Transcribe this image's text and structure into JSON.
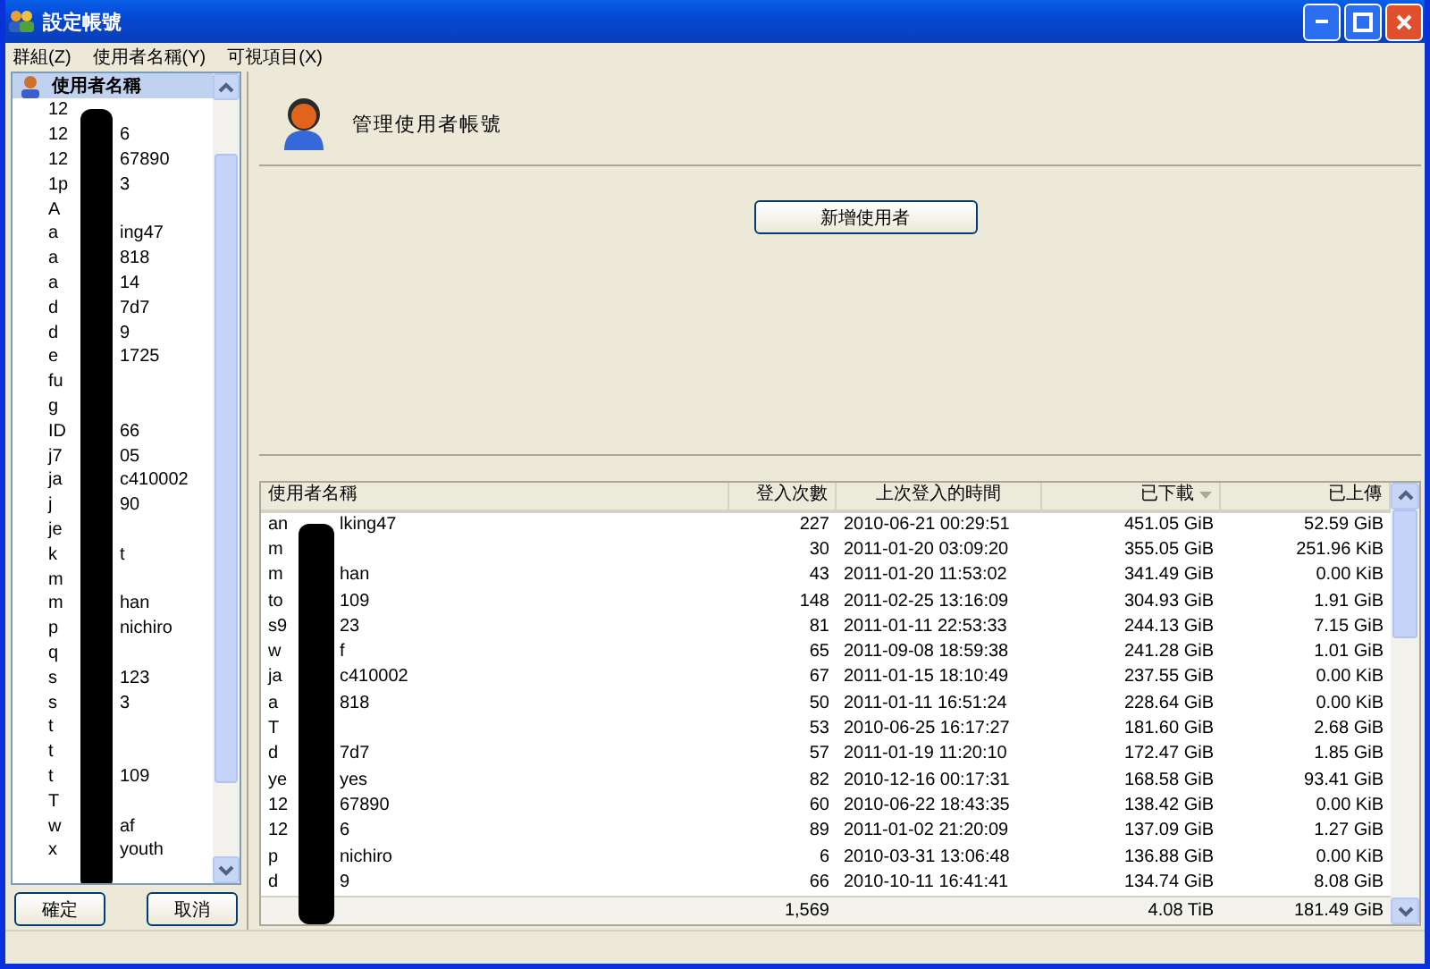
{
  "window": {
    "title": "設定帳號"
  },
  "menu": [
    "群組(Z)",
    "使用者名稱(Y)",
    "可視項目(X)"
  ],
  "sidebar": {
    "header": {
      "label": "使用者名稱",
      "selected": true
    },
    "items": [
      {
        "head": "12"
      },
      {
        "head": "12",
        "tail": "6"
      },
      {
        "head": "12",
        "tail": "67890"
      },
      {
        "head": "1p",
        "tail": "3"
      },
      {
        "head": "A"
      },
      {
        "head": "a",
        "tail": "ing47"
      },
      {
        "head": "a",
        "tail": "818"
      },
      {
        "head": "a",
        "tail": "14"
      },
      {
        "head": "d",
        "tail": "7d7"
      },
      {
        "head": "d",
        "tail": "9"
      },
      {
        "head": "e",
        "tail": "1725"
      },
      {
        "head": "fu"
      },
      {
        "head": "g"
      },
      {
        "head": "ID",
        "tail": "66"
      },
      {
        "head": "j7",
        "tail": "05"
      },
      {
        "head": "ja",
        "tail": "c410002"
      },
      {
        "head": "j",
        "tail": "90"
      },
      {
        "head": "je"
      },
      {
        "head": "k",
        "tail": "t"
      },
      {
        "head": "m"
      },
      {
        "head": "m",
        "tail": "han"
      },
      {
        "head": "p",
        "tail": "nichiro"
      },
      {
        "head": "q"
      },
      {
        "head": "s",
        "tail": "123"
      },
      {
        "head": "s",
        "tail": "3"
      },
      {
        "head": "t"
      },
      {
        "head": "t"
      },
      {
        "head": "t",
        "tail": "109"
      },
      {
        "head": "T"
      },
      {
        "head": "w",
        "tail": "af"
      },
      {
        "head": "x",
        "tail": "youth"
      }
    ]
  },
  "buttons": [
    "確定",
    "取消"
  ],
  "panel": {
    "title": "管理使用者帳號",
    "add_button": "新增使用者"
  },
  "table": {
    "columns": [
      {
        "label": "使用者名稱",
        "sorted": false
      },
      {
        "label": "登入次數",
        "sorted": false
      },
      {
        "label": "上次登入的時間",
        "sorted": false
      },
      {
        "label": "已下載",
        "sorted": true
      },
      {
        "label": "已上傳",
        "sorted": false
      }
    ],
    "rows": [
      {
        "head": "an",
        "tail": "lking47",
        "logins": "227",
        "last": "2010-06-21 00:29:51",
        "down": "451.05 GiB",
        "up": "52.59 GiB"
      },
      {
        "head": "m",
        "logins": "30",
        "last": "2011-01-20 03:09:20",
        "down": "355.05 GiB",
        "up": "251.96 KiB"
      },
      {
        "head": "m",
        "tail": "han",
        "logins": "43",
        "last": "2011-01-20 11:53:02",
        "down": "341.49 GiB",
        "up": "0.00 KiB"
      },
      {
        "head": "to",
        "tail": "109",
        "logins": "148",
        "last": "2011-02-25 13:16:09",
        "down": "304.93 GiB",
        "up": "1.91 GiB"
      },
      {
        "head": "s9",
        "tail": "23",
        "logins": "81",
        "last": "2011-01-11 22:53:33",
        "down": "244.13 GiB",
        "up": "7.15 GiB"
      },
      {
        "head": "w",
        "tail": "f",
        "logins": "65",
        "last": "2011-09-08 18:59:38",
        "down": "241.28 GiB",
        "up": "1.01 GiB"
      },
      {
        "head": "ja",
        "tail": "c410002",
        "logins": "67",
        "last": "2011-01-15 18:10:49",
        "down": "237.55 GiB",
        "up": "0.00 KiB"
      },
      {
        "head": "a",
        "tail": "818",
        "logins": "50",
        "last": "2011-01-11 16:51:24",
        "down": "228.64 GiB",
        "up": "0.00 KiB"
      },
      {
        "head": "T",
        "logins": "53",
        "last": "2010-06-25 16:17:27",
        "down": "181.60 GiB",
        "up": "2.68 GiB"
      },
      {
        "head": "d",
        "tail": "7d7",
        "logins": "57",
        "last": "2011-01-19 11:20:10",
        "down": "172.47 GiB",
        "up": "1.85 GiB"
      },
      {
        "head": "ye",
        "tail": "yes",
        "logins": "82",
        "last": "2010-12-16 00:17:31",
        "down": "168.58 GiB",
        "up": "93.41 GiB"
      },
      {
        "head": "12",
        "tail": "67890",
        "logins": "60",
        "last": "2010-06-22 18:43:35",
        "down": "138.42 GiB",
        "up": "0.00 KiB"
      },
      {
        "head": "12",
        "tail": "6",
        "logins": "89",
        "last": "2011-01-02 21:20:09",
        "down": "137.09 GiB",
        "up": "1.27 GiB"
      },
      {
        "head": "p",
        "tail": "nichiro",
        "logins": "6",
        "last": "2010-03-31 13:06:48",
        "down": "136.88 GiB",
        "up": "0.00 KiB"
      },
      {
        "head": "d",
        "tail": "9",
        "logins": "66",
        "last": "2010-10-11 16:41:41",
        "down": "134.74 GiB",
        "up": "8.08 GiB"
      }
    ],
    "totals": {
      "logins": "1,569",
      "down": "4.08 TiB",
      "up": "181.49 GiB"
    }
  }
}
